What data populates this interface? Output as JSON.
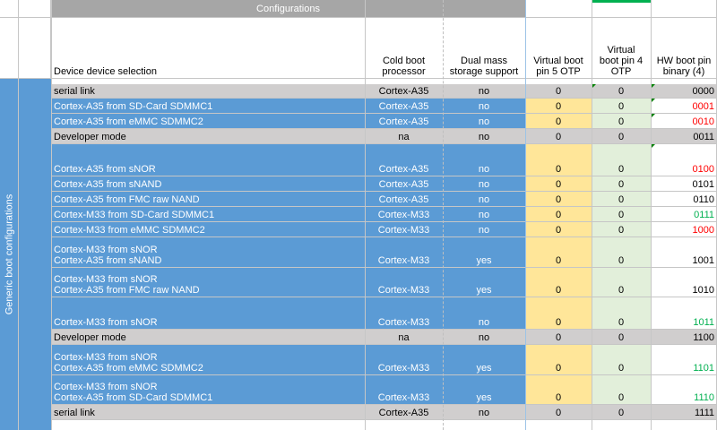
{
  "header": {
    "band_title": "Configurations",
    "col_device": "Device device selection",
    "col_cold_boot": [
      "Cold boot",
      "processor"
    ],
    "col_dual_mass": [
      "Dual mass",
      "storage support"
    ],
    "col_vbp5": [
      "Virtual boot",
      "pin 5 OTP"
    ],
    "col_vbp4": [
      "Virtual",
      "boot pin 4",
      "OTP"
    ],
    "col_hw": [
      "HW boot pin",
      "binary (4)"
    ]
  },
  "sidebar": {
    "label": "Generic boot configurations"
  },
  "rows": [
    {
      "lines": [
        "serial link"
      ],
      "proc": "Cortex-A35",
      "dual": "no",
      "p5": "0",
      "p4": "0",
      "hw": "0000",
      "hwc": "blk",
      "style": "gray"
    },
    {
      "lines": [
        "Cortex-A35 from SD-Card SDMMC1"
      ],
      "proc": "Cortex-A35",
      "dual": "no",
      "p5": "0",
      "p4": "0",
      "hw": "0001",
      "hwc": "red",
      "style": "blue"
    },
    {
      "lines": [
        "Cortex-A35 from eMMC SDMMC2"
      ],
      "proc": "Cortex-A35",
      "dual": "no",
      "p5": "0",
      "p4": "0",
      "hw": "0010",
      "hwc": "red",
      "style": "blue"
    },
    {
      "lines": [
        "Developer mode"
      ],
      "proc": "na",
      "dual": "no",
      "p5": "0",
      "p4": "0",
      "hw": "0011",
      "hwc": "blk",
      "style": "gray"
    },
    {
      "lines": [
        "Cortex-A35 from sNOR"
      ],
      "proc": "Cortex-A35",
      "dual": "no",
      "p5": "0",
      "p4": "0",
      "hw": "0100",
      "hwc": "red",
      "style": "blue"
    },
    {
      "lines": [
        "Cortex-A35 from sNAND"
      ],
      "proc": "Cortex-A35",
      "dual": "no",
      "p5": "0",
      "p4": "0",
      "hw": "0101",
      "hwc": "blk",
      "style": "blue"
    },
    {
      "lines": [
        "Cortex-A35 from FMC raw NAND"
      ],
      "proc": "Cortex-A35",
      "dual": "no",
      "p5": "0",
      "p4": "0",
      "hw": "0110",
      "hwc": "blk",
      "style": "blue"
    },
    {
      "lines": [
        "Cortex-M33 from SD-Card SDMMC1"
      ],
      "proc": "Cortex-M33",
      "dual": "no",
      "p5": "0",
      "p4": "0",
      "hw": "0111",
      "hwc": "grn",
      "style": "blue"
    },
    {
      "lines": [
        "Cortex-M33 from eMMC SDMMC2"
      ],
      "proc": "Cortex-M33",
      "dual": "no",
      "p5": "0",
      "p4": "0",
      "hw": "1000",
      "hwc": "red",
      "style": "blue"
    },
    {
      "lines": [
        "Cortex-M33 from sNOR",
        "Cortex-A35 from sNAND"
      ],
      "proc": "Cortex-M33",
      "dual": "yes",
      "p5": "0",
      "p4": "0",
      "hw": "1001",
      "hwc": "blk",
      "style": "blue"
    },
    {
      "lines": [
        "Cortex-M33 from sNOR",
        "Cortex-A35 from FMC raw NAND"
      ],
      "proc": "Cortex-M33",
      "dual": "yes",
      "p5": "0",
      "p4": "0",
      "hw": "1010",
      "hwc": "blk",
      "style": "blue"
    },
    {
      "lines": [
        "Cortex-M33 from sNOR"
      ],
      "proc": "Cortex-M33",
      "dual": "no",
      "p5": "0",
      "p4": "0",
      "hw": "1011",
      "hwc": "grn",
      "style": "blue"
    },
    {
      "lines": [
        "Developer mode"
      ],
      "proc": "na",
      "dual": "no",
      "p5": "0",
      "p4": "0",
      "hw": "1100",
      "hwc": "blk",
      "style": "gray"
    },
    {
      "lines": [
        "Cortex-M33 from sNOR",
        "Cortex-A35 from eMMC SDMMC2"
      ],
      "proc": "Cortex-M33",
      "dual": "yes",
      "p5": "0",
      "p4": "0",
      "hw": "1101",
      "hwc": "grn",
      "style": "blue"
    },
    {
      "lines": [
        "Cortex-M33 from sNOR",
        "Cortex-A35 from SD-Card SDMMC1"
      ],
      "proc": "Cortex-M33",
      "dual": "yes",
      "p5": "0",
      "p4": "0",
      "hw": "1110",
      "hwc": "grn",
      "style": "blue"
    },
    {
      "lines": [
        "serial link"
      ],
      "proc": "Cortex-A35",
      "dual": "no",
      "p5": "0",
      "p4": "0",
      "hw": "1111",
      "hwc": "blk",
      "style": "gray"
    }
  ]
}
